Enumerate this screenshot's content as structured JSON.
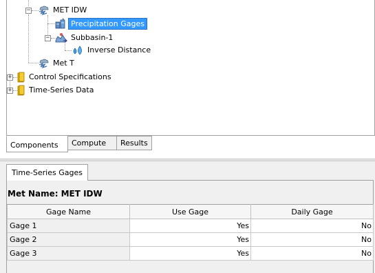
{
  "tree": {
    "nodes": [
      {
        "label": "MET IDW",
        "icon": "meteorologic-model-icon"
      },
      {
        "label": "Precipitation Gages",
        "icon": "precipitation-gages-icon",
        "selected": true
      },
      {
        "label": "Subbasin-1",
        "icon": "subbasin-icon"
      },
      {
        "label": "Inverse Distance",
        "icon": "water-drops-icon"
      },
      {
        "label": "Met T",
        "icon": "meteorologic-model-icon"
      },
      {
        "label": "Control Specifications",
        "icon": "folder-icon"
      },
      {
        "label": "Time-Series Data",
        "icon": "folder-icon"
      }
    ]
  },
  "component_tabs": [
    {
      "label": "Components",
      "active": true
    },
    {
      "label": "Compute",
      "active": false
    },
    {
      "label": "Results",
      "active": false
    }
  ],
  "panel_tab": {
    "label": "Time-Series Gages"
  },
  "met_name": {
    "label": "Met Name:",
    "value": "MET IDW"
  },
  "table": {
    "headers": [
      "Gage Name",
      "Use Gage",
      "Daily Gage"
    ],
    "rows": [
      [
        "Gage 1",
        "Yes",
        "No"
      ],
      [
        "Gage 2",
        "Yes",
        "No"
      ],
      [
        "Gage 3",
        "Yes",
        "No"
      ]
    ]
  },
  "colors": {
    "selection": "#3399ff",
    "folder": "#e8b400"
  }
}
